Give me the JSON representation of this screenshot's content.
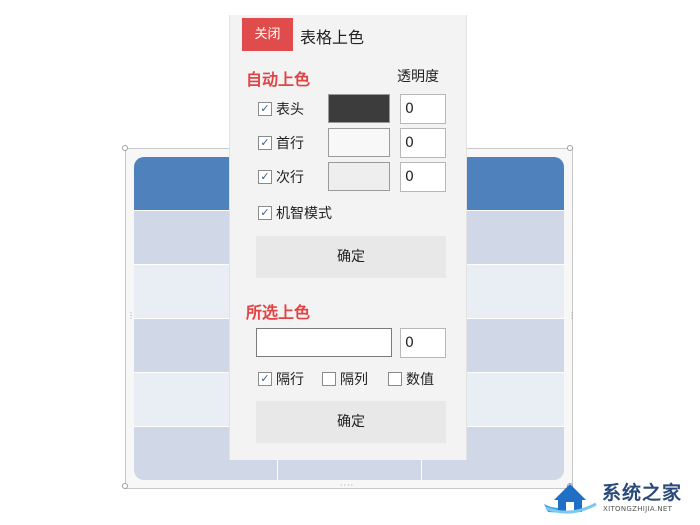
{
  "panel": {
    "close_label": "关闭",
    "title": "表格上色"
  },
  "auto_color": {
    "section_title": "自动上色",
    "opacity_heading": "透明度",
    "rows": [
      {
        "label": "表头",
        "checked": true,
        "color": "#3c3c3c",
        "opacity": "0"
      },
      {
        "label": "首行",
        "checked": true,
        "color": "#f8f8f8",
        "opacity": "0"
      },
      {
        "label": "次行",
        "checked": true,
        "color": "#eeeeee",
        "opacity": "0"
      }
    ],
    "smart_mode": {
      "label": "机智模式",
      "checked": true
    },
    "confirm_label": "确定"
  },
  "selected_color": {
    "section_title": "所选上色",
    "color": "#ffffff",
    "opacity": "0",
    "options": [
      {
        "label": "隔行",
        "checked": true
      },
      {
        "label": "隔列",
        "checked": false
      },
      {
        "label": "数值",
        "checked": false
      }
    ],
    "confirm_label": "确定"
  },
  "table": {
    "header_color": "#4f81bd",
    "band_color_1": "#d0d8e8",
    "band_color_2": "#e9edf4"
  },
  "watermark": {
    "text": "系统之家",
    "sub": "XITONGZHIJIA.NET"
  }
}
